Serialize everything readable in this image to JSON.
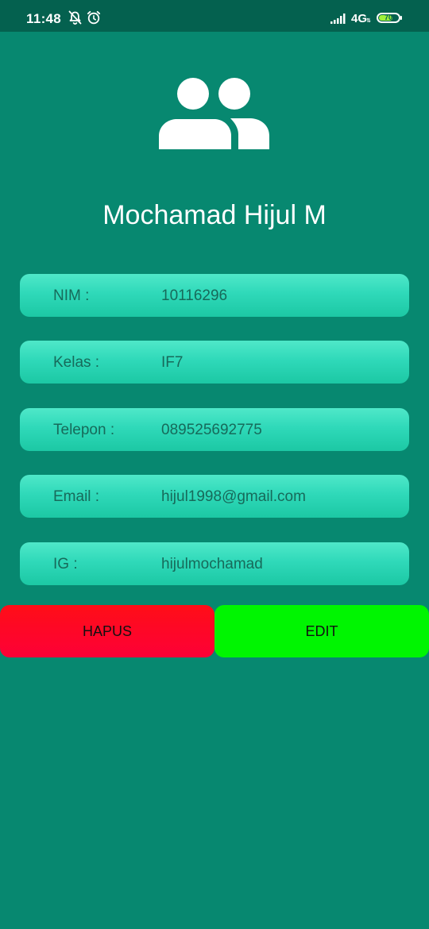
{
  "status_bar": {
    "time": "11:48",
    "network": "4G",
    "network_sub": "⇅",
    "battery": "70",
    "battery_level": 0.7,
    "icons": [
      "notifications-off-icon",
      "alarm-icon",
      "signal-icon",
      "battery-icon"
    ]
  },
  "profile": {
    "avatar_icon": "people-icon",
    "name": "Mochamad Hijul M"
  },
  "fields": [
    {
      "label": "NIM :",
      "value": "10116296"
    },
    {
      "label": "Kelas :",
      "value": "IF7"
    },
    {
      "label": "Telepon :",
      "value": "089525692775"
    },
    {
      "label": "Email :",
      "value": "hijul1998@gmail.com"
    },
    {
      "label": "IG :",
      "value": "hijulmochamad"
    }
  ],
  "actions": {
    "delete_label": "HAPUS",
    "edit_label": "EDIT"
  },
  "colors": {
    "background": "#078870",
    "status_bar": "#04614f",
    "card": "#2fd9b9",
    "card_text": "#176a5a",
    "delete_button": "#ff0e17",
    "edit_button": "#00f501"
  }
}
